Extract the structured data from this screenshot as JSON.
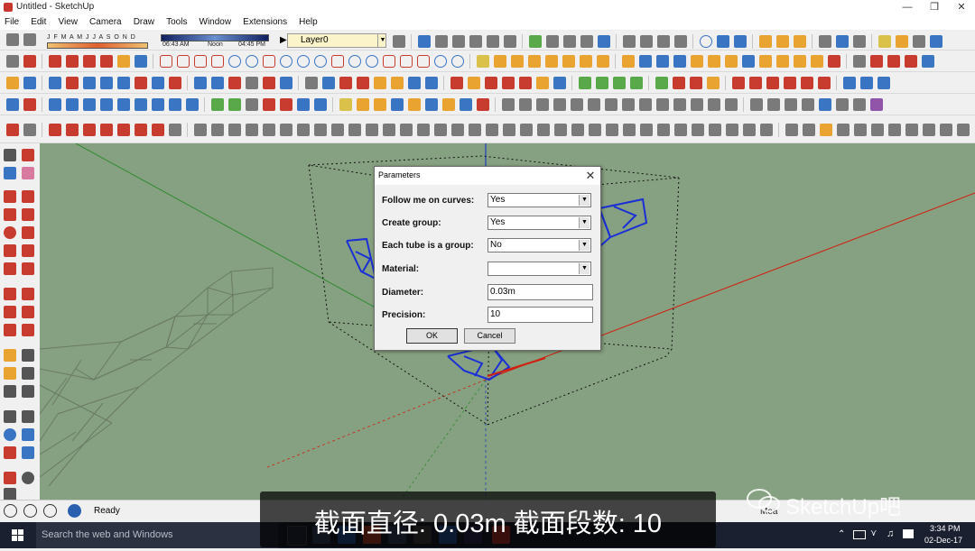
{
  "window": {
    "title": "Untitled - SketchUp"
  },
  "menu": [
    "File",
    "Edit",
    "View",
    "Camera",
    "Draw",
    "Tools",
    "Window",
    "Extensions",
    "Help"
  ],
  "shadow": {
    "months": "J F M A M J J A S O N D",
    "time_start": "06:43 AM",
    "time_mid": "Noon",
    "time_end": "04:45 PM"
  },
  "layer": {
    "value": "Layer0"
  },
  "dialog": {
    "title": "Parameters",
    "close": "✕",
    "rows": [
      {
        "label": "Follow me on curves:",
        "value": "Yes",
        "kind": "select"
      },
      {
        "label": "Create group:",
        "value": "Yes",
        "kind": "select"
      },
      {
        "label": "Each tube is a group:",
        "value": "No",
        "kind": "select"
      },
      {
        "label": "Material:",
        "value": "",
        "kind": "select"
      },
      {
        "label": "Diameter:",
        "value": "0.03m",
        "kind": "input"
      },
      {
        "label": "Precision:",
        "value": "10",
        "kind": "input"
      }
    ],
    "ok": "OK",
    "cancel": "Cancel"
  },
  "status": {
    "text": "Ready",
    "measurements_label": "Mea"
  },
  "taskbar": {
    "search_placeholder": "Search the web and Windows",
    "time": "3:34 PM",
    "date": "02-Dec-17"
  },
  "caption": {
    "text": "截面直径: 0.03m   截面段数: 10"
  },
  "watermark": {
    "text": "SketchUp吧"
  },
  "colors": {
    "viewport": "#86a181",
    "selection_blue": "#1a2fd6",
    "axis_red": "#d02010",
    "axis_green": "#2f8a2f",
    "axis_blue": "#2040c0",
    "taskbar": "#1b2030"
  }
}
